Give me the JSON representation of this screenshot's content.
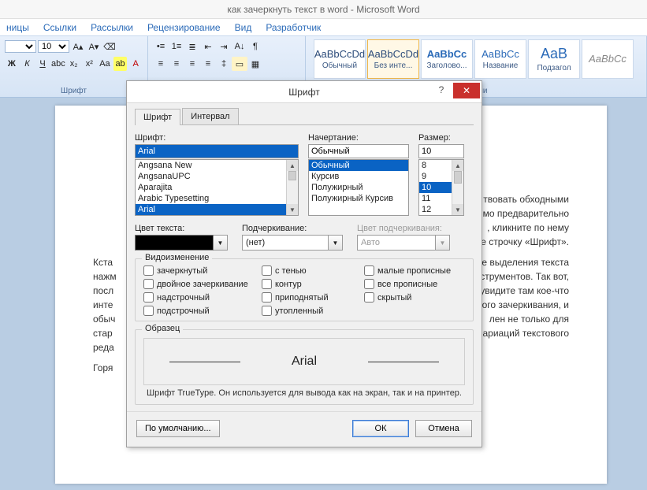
{
  "window": {
    "title": "как зачеркнуть текст в word - Microsoft Word"
  },
  "tabs": {
    "t0": "ницы",
    "t1": "Ссылки",
    "t2": "Рассылки",
    "t3": "Рецензирование",
    "t4": "Вид",
    "t5": "Разработчик"
  },
  "ribbon": {
    "font_size": "10",
    "group_font": "Шрифт",
    "group_styles": "Стили",
    "btn_bold": "Ж",
    "btn_italic": "К",
    "btn_underline": "Ч",
    "styles": {
      "s0": {
        "prev": "AaBbCcDd",
        "name": "Обычный"
      },
      "s1": {
        "prev": "AaBbCcDd",
        "name": "Без инте..."
      },
      "s2": {
        "prev": "AaBbCc",
        "name": "Заголово..."
      },
      "s3": {
        "prev": "AaBbCc",
        "name": "Название"
      },
      "s4": {
        "prev": "AaB",
        "name": "Подзагол"
      },
      "s5": {
        "prev": "AaBbCc",
        "name": ""
      }
    }
  },
  "doc": {
    "l0": "Кста",
    "l1": "нажм",
    "l2": "посл",
    "l3": "инте",
    "l4": "обыч",
    "l5": "стар",
    "l6": "реда",
    "l7": "Горя",
    "r0": "твовать обходными",
    "r1": "имо предварительно",
    "r2": ", кликните по нему",
    "r3": "е строчку «Шрифт».",
    "r4": "е выделения текста",
    "r5": "струментов. Так вот,",
    "r6": "увидите там кое-что",
    "r7": "ого зачеркивания, и",
    "r8": "лен не только для",
    "r9": "ариаций текстового"
  },
  "dialog": {
    "title": "Шрифт",
    "help": "?",
    "close": "✕",
    "tab_font": "Шрифт",
    "tab_spacing": "Интервал",
    "lbl_font": "Шрифт:",
    "lbl_style": "Начертание:",
    "lbl_size": "Размер:",
    "font_value": "Arial",
    "style_value": "Обычный",
    "size_value": "10",
    "fonts": {
      "f0": "Angsana New",
      "f1": "AngsanaUPC",
      "f2": "Aparajita",
      "f3": "Arabic Typesetting",
      "f4": "Arial"
    },
    "styles_list": {
      "s0": "Обычный",
      "s1": "Курсив",
      "s2": "Полужирный",
      "s3": "Полужирный Курсив"
    },
    "sizes": {
      "z0": "8",
      "z1": "9",
      "z2": "10",
      "z3": "11",
      "z4": "12"
    },
    "lbl_color": "Цвет текста:",
    "lbl_underline": "Подчеркивание:",
    "lbl_ul_color": "Цвет подчеркивания:",
    "underline_value": "(нет)",
    "ul_color_value": "Авто",
    "grp_effects": "Видоизменение",
    "chk": {
      "strike": "зачеркнутый",
      "dstrike": "двойное зачеркивание",
      "super": "надстрочный",
      "sub": "подстрочный",
      "shadow": "с тенью",
      "outline": "контур",
      "emboss": "приподнятый",
      "engrave": "утопленный",
      "smallcaps": "малые прописные",
      "allcaps": "все прописные",
      "hidden": "скрытый"
    },
    "grp_sample": "Образец",
    "sample_text": "Arial",
    "note": "Шрифт TrueType. Он используется для вывода как на экран, так и на принтер.",
    "btn_default": "По умолчанию...",
    "btn_ok": "ОК",
    "btn_cancel": "Отмена"
  }
}
